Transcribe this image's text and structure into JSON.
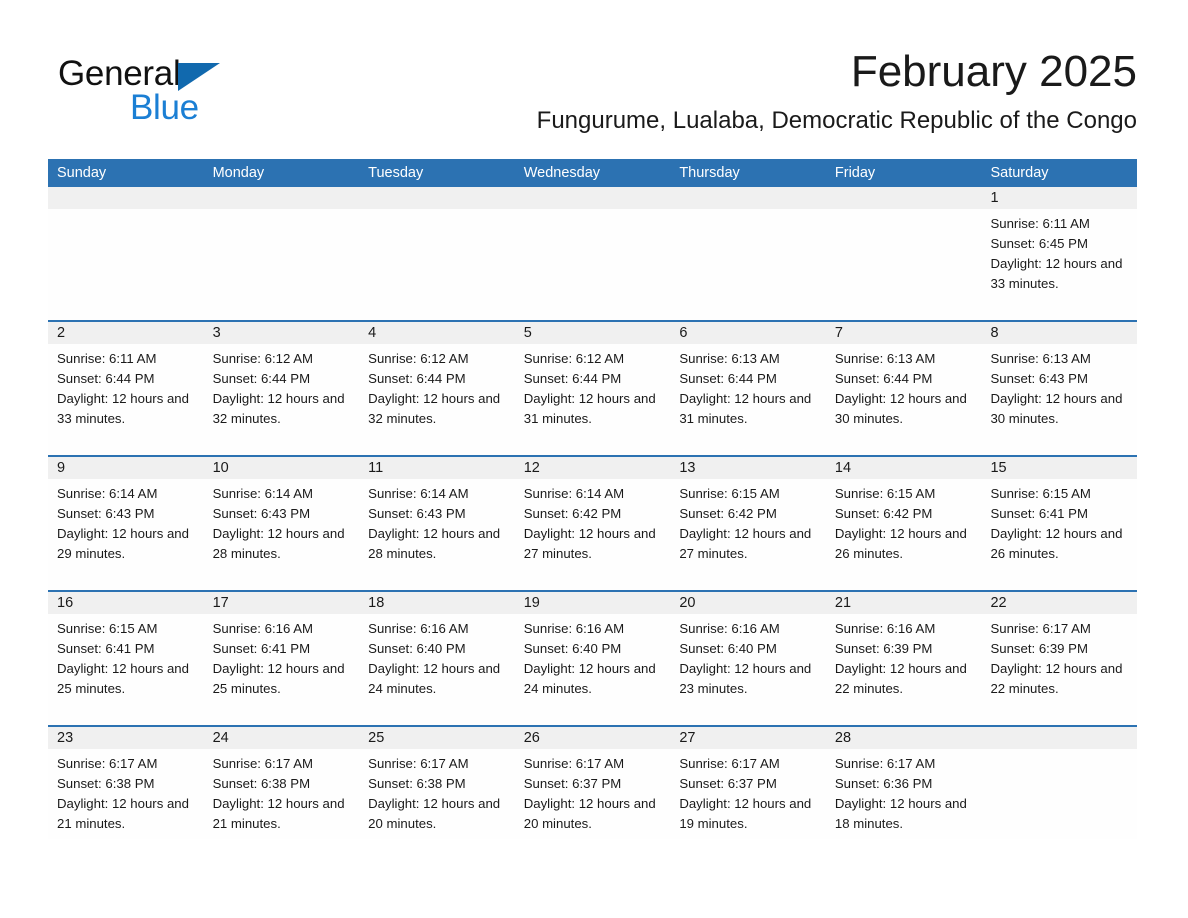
{
  "brand": {
    "word_general": "General",
    "word_blue": "Blue",
    "triangle_color": "#1169AE",
    "blue_text_color": "#1B7FD4"
  },
  "header": {
    "title": "February 2025",
    "subtitle": "Fungurume, Lualaba, Democratic Republic of the Congo",
    "header_bg_color": "#2C72B2",
    "day_band_color": "#F0F0F0"
  },
  "weekdays": [
    "Sunday",
    "Monday",
    "Tuesday",
    "Wednesday",
    "Thursday",
    "Friday",
    "Saturday"
  ],
  "weeks": [
    [
      {
        "day": "",
        "sunrise": "",
        "sunset": "",
        "daylight": ""
      },
      {
        "day": "",
        "sunrise": "",
        "sunset": "",
        "daylight": ""
      },
      {
        "day": "",
        "sunrise": "",
        "sunset": "",
        "daylight": ""
      },
      {
        "day": "",
        "sunrise": "",
        "sunset": "",
        "daylight": ""
      },
      {
        "day": "",
        "sunrise": "",
        "sunset": "",
        "daylight": ""
      },
      {
        "day": "",
        "sunrise": "",
        "sunset": "",
        "daylight": ""
      },
      {
        "day": "1",
        "sunrise": "Sunrise: 6:11 AM",
        "sunset": "Sunset: 6:45 PM",
        "daylight": "Daylight: 12 hours and 33 minutes."
      }
    ],
    [
      {
        "day": "2",
        "sunrise": "Sunrise: 6:11 AM",
        "sunset": "Sunset: 6:44 PM",
        "daylight": "Daylight: 12 hours and 33 minutes."
      },
      {
        "day": "3",
        "sunrise": "Sunrise: 6:12 AM",
        "sunset": "Sunset: 6:44 PM",
        "daylight": "Daylight: 12 hours and 32 minutes."
      },
      {
        "day": "4",
        "sunrise": "Sunrise: 6:12 AM",
        "sunset": "Sunset: 6:44 PM",
        "daylight": "Daylight: 12 hours and 32 minutes."
      },
      {
        "day": "5",
        "sunrise": "Sunrise: 6:12 AM",
        "sunset": "Sunset: 6:44 PM",
        "daylight": "Daylight: 12 hours and 31 minutes."
      },
      {
        "day": "6",
        "sunrise": "Sunrise: 6:13 AM",
        "sunset": "Sunset: 6:44 PM",
        "daylight": "Daylight: 12 hours and 31 minutes."
      },
      {
        "day": "7",
        "sunrise": "Sunrise: 6:13 AM",
        "sunset": "Sunset: 6:44 PM",
        "daylight": "Daylight: 12 hours and 30 minutes."
      },
      {
        "day": "8",
        "sunrise": "Sunrise: 6:13 AM",
        "sunset": "Sunset: 6:43 PM",
        "daylight": "Daylight: 12 hours and 30 minutes."
      }
    ],
    [
      {
        "day": "9",
        "sunrise": "Sunrise: 6:14 AM",
        "sunset": "Sunset: 6:43 PM",
        "daylight": "Daylight: 12 hours and 29 minutes."
      },
      {
        "day": "10",
        "sunrise": "Sunrise: 6:14 AM",
        "sunset": "Sunset: 6:43 PM",
        "daylight": "Daylight: 12 hours and 28 minutes."
      },
      {
        "day": "11",
        "sunrise": "Sunrise: 6:14 AM",
        "sunset": "Sunset: 6:43 PM",
        "daylight": "Daylight: 12 hours and 28 minutes."
      },
      {
        "day": "12",
        "sunrise": "Sunrise: 6:14 AM",
        "sunset": "Sunset: 6:42 PM",
        "daylight": "Daylight: 12 hours and 27 minutes."
      },
      {
        "day": "13",
        "sunrise": "Sunrise: 6:15 AM",
        "sunset": "Sunset: 6:42 PM",
        "daylight": "Daylight: 12 hours and 27 minutes."
      },
      {
        "day": "14",
        "sunrise": "Sunrise: 6:15 AM",
        "sunset": "Sunset: 6:42 PM",
        "daylight": "Daylight: 12 hours and 26 minutes."
      },
      {
        "day": "15",
        "sunrise": "Sunrise: 6:15 AM",
        "sunset": "Sunset: 6:41 PM",
        "daylight": "Daylight: 12 hours and 26 minutes."
      }
    ],
    [
      {
        "day": "16",
        "sunrise": "Sunrise: 6:15 AM",
        "sunset": "Sunset: 6:41 PM",
        "daylight": "Daylight: 12 hours and 25 minutes."
      },
      {
        "day": "17",
        "sunrise": "Sunrise: 6:16 AM",
        "sunset": "Sunset: 6:41 PM",
        "daylight": "Daylight: 12 hours and 25 minutes."
      },
      {
        "day": "18",
        "sunrise": "Sunrise: 6:16 AM",
        "sunset": "Sunset: 6:40 PM",
        "daylight": "Daylight: 12 hours and 24 minutes."
      },
      {
        "day": "19",
        "sunrise": "Sunrise: 6:16 AM",
        "sunset": "Sunset: 6:40 PM",
        "daylight": "Daylight: 12 hours and 24 minutes."
      },
      {
        "day": "20",
        "sunrise": "Sunrise: 6:16 AM",
        "sunset": "Sunset: 6:40 PM",
        "daylight": "Daylight: 12 hours and 23 minutes."
      },
      {
        "day": "21",
        "sunrise": "Sunrise: 6:16 AM",
        "sunset": "Sunset: 6:39 PM",
        "daylight": "Daylight: 12 hours and 22 minutes."
      },
      {
        "day": "22",
        "sunrise": "Sunrise: 6:17 AM",
        "sunset": "Sunset: 6:39 PM",
        "daylight": "Daylight: 12 hours and 22 minutes."
      }
    ],
    [
      {
        "day": "23",
        "sunrise": "Sunrise: 6:17 AM",
        "sunset": "Sunset: 6:38 PM",
        "daylight": "Daylight: 12 hours and 21 minutes."
      },
      {
        "day": "24",
        "sunrise": "Sunrise: 6:17 AM",
        "sunset": "Sunset: 6:38 PM",
        "daylight": "Daylight: 12 hours and 21 minutes."
      },
      {
        "day": "25",
        "sunrise": "Sunrise: 6:17 AM",
        "sunset": "Sunset: 6:38 PM",
        "daylight": "Daylight: 12 hours and 20 minutes."
      },
      {
        "day": "26",
        "sunrise": "Sunrise: 6:17 AM",
        "sunset": "Sunset: 6:37 PM",
        "daylight": "Daylight: 12 hours and 20 minutes."
      },
      {
        "day": "27",
        "sunrise": "Sunrise: 6:17 AM",
        "sunset": "Sunset: 6:37 PM",
        "daylight": "Daylight: 12 hours and 19 minutes."
      },
      {
        "day": "28",
        "sunrise": "Sunrise: 6:17 AM",
        "sunset": "Sunset: 6:36 PM",
        "daylight": "Daylight: 12 hours and 18 minutes."
      },
      {
        "day": "",
        "sunrise": "",
        "sunset": "",
        "daylight": ""
      }
    ]
  ]
}
